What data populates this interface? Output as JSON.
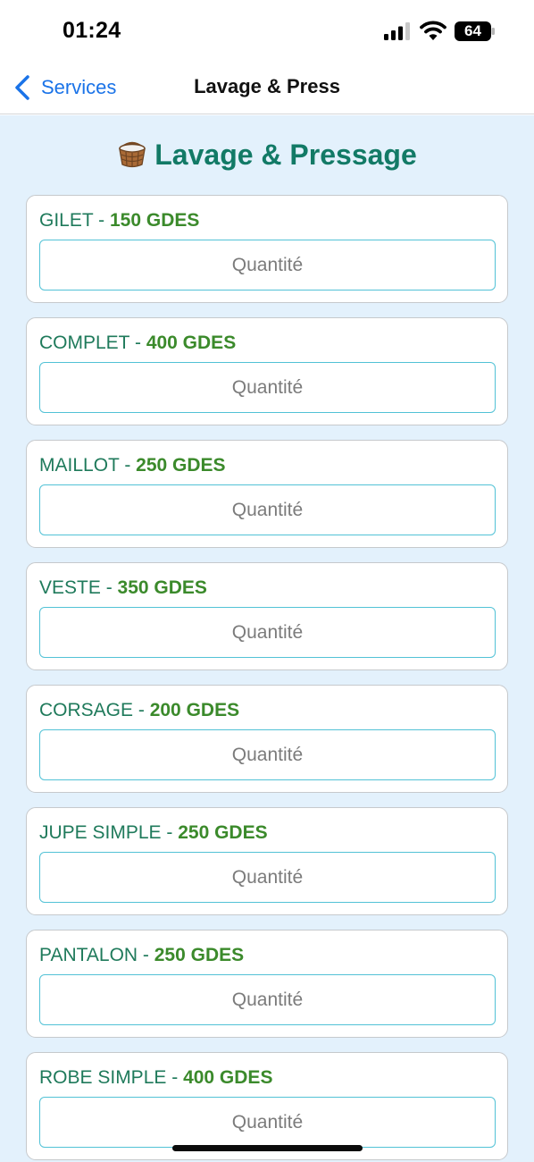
{
  "status_bar": {
    "time": "01:24",
    "battery_level": "64"
  },
  "nav": {
    "back_label": "Services",
    "title": "Lavage & Press"
  },
  "page": {
    "icon": "basket-icon",
    "heading": "Lavage & Pressage"
  },
  "items": [
    {
      "name": "GILET",
      "separator": " - ",
      "price": "150 GDES",
      "placeholder": "Quantité"
    },
    {
      "name": "COMPLET",
      "separator": " - ",
      "price": "400 GDES",
      "placeholder": "Quantité"
    },
    {
      "name": "MAILLOT",
      "separator": " - ",
      "price": "250 GDES",
      "placeholder": "Quantité"
    },
    {
      "name": "VESTE",
      "separator": " - ",
      "price": "350 GDES",
      "placeholder": "Quantité"
    },
    {
      "name": "CORSAGE",
      "separator": " - ",
      "price": "200 GDES",
      "placeholder": "Quantité"
    },
    {
      "name": "JUPE SIMPLE",
      "separator": " - ",
      "price": "250 GDES",
      "placeholder": "Quantité"
    },
    {
      "name": "PANTALON",
      "separator": " - ",
      "price": "250 GDES",
      "placeholder": "Quantité"
    },
    {
      "name": "ROBE SIMPLE",
      "separator": " - ",
      "price": "400 GDES",
      "placeholder": "Quantité"
    }
  ],
  "colors": {
    "accent": "#1a73e8",
    "heading": "#127a66",
    "price": "#3b8a2b",
    "input_border": "#52c2d6",
    "background": "#e3f1fc"
  }
}
